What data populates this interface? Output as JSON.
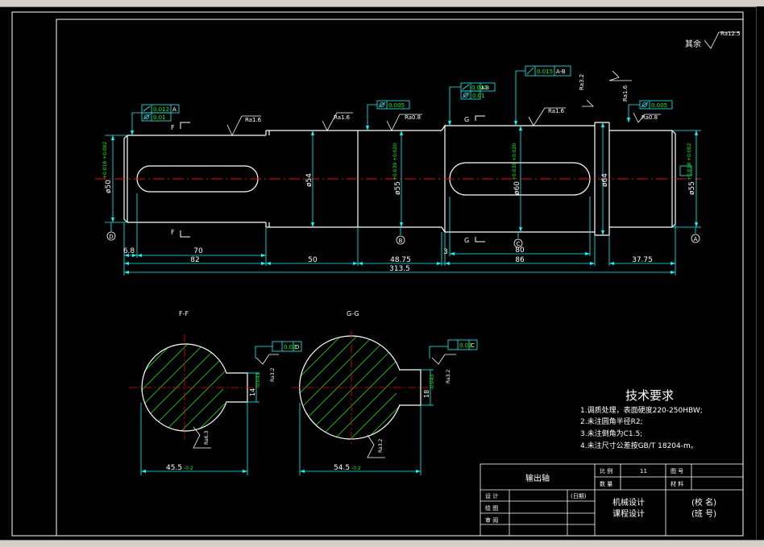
{
  "colors": {
    "background": "#000000",
    "frame": "#ffffff",
    "outline": "#ffffff",
    "centerline": "#ff0000",
    "dimension": "#00ffff",
    "tolerance": "#00ff00",
    "hatch": "#00ff00",
    "text": "#ffffff"
  },
  "roughness": {
    "default_label": "其余",
    "default_value": "Ra12.5",
    "marks": [
      "Ra1.6",
      "Ra1.6",
      "Ra0.8",
      "Ra1.6",
      "Ra3.2",
      "Ra1.6",
      "Ra0.8",
      "Ra3.2",
      "Ra6.3",
      "Ra3.2",
      "Ra3.2"
    ]
  },
  "gdt": {
    "f1_value": "0.012",
    "f1_datum": "A",
    "f2_value": "0.01",
    "f3_value": "0.005",
    "f4_value": "0.015",
    "f4_datum": "A-B",
    "f5_value": "0.01",
    "f6_value": "0.015",
    "f6_datum": "A-B",
    "f7_value": "0.005",
    "f8_value": "0.02",
    "f8_datum": "D",
    "f9_value": "0.02",
    "f9_datum": "C"
  },
  "diameters": {
    "d1": "ø50",
    "d1_tol": "+0.018 +0.002",
    "d2": "ø54",
    "d3": "ø55",
    "d3_tol": "+0.039 +0.020",
    "d4": "ø60",
    "d4_tol": "+0.039 +0.020",
    "d5": "ø64",
    "d6": "ø55",
    "d6_tol": "+0.018 +0.002"
  },
  "lengths": {
    "l_68": "6.8",
    "l_70": "70",
    "l_82": "82",
    "l_50": "50",
    "l_4875": "48.75",
    "l_3": "3",
    "l_80": "80",
    "l_86": "86",
    "l_3775": "37.75",
    "l_total": "313.5"
  },
  "datums": {
    "d": "D",
    "b": "B",
    "c": "C",
    "a": "A"
  },
  "section_marks": {
    "f": "F",
    "g": "G"
  },
  "sections": {
    "ff_title": "F-F",
    "ff_width": "45.5",
    "ff_width_tol": "-0.2",
    "ff_key": "14",
    "ff_key_tol": "-0.043",
    "gg_title": "G-G",
    "gg_width": "54.5",
    "gg_width_tol": "-0.2",
    "gg_key": "18",
    "gg_key_tol": "-0.043"
  },
  "notes": {
    "title": "技术要求",
    "items": [
      "1.调质处理，表面硬度220-250HBW;",
      "2.未注圆角半径R2;",
      "3.未注倒角为C1.5;",
      "4.未注尺寸公差按GB/T 18204-m。"
    ]
  },
  "titleblock": {
    "part_name": "输出轴",
    "scale_label": "比 例",
    "scale_value": "11",
    "drawing_no_label": "图 号",
    "qty_label": "数 量",
    "material_label": "材 料",
    "design_label": "设 计",
    "date_label": "(日期)",
    "draw_label": "绘 图",
    "check_label": "审 阅",
    "course_line1": "机械设计",
    "course_line2": "课程设计",
    "school_line1": "(校 名)",
    "school_line2": "(班 号)"
  }
}
